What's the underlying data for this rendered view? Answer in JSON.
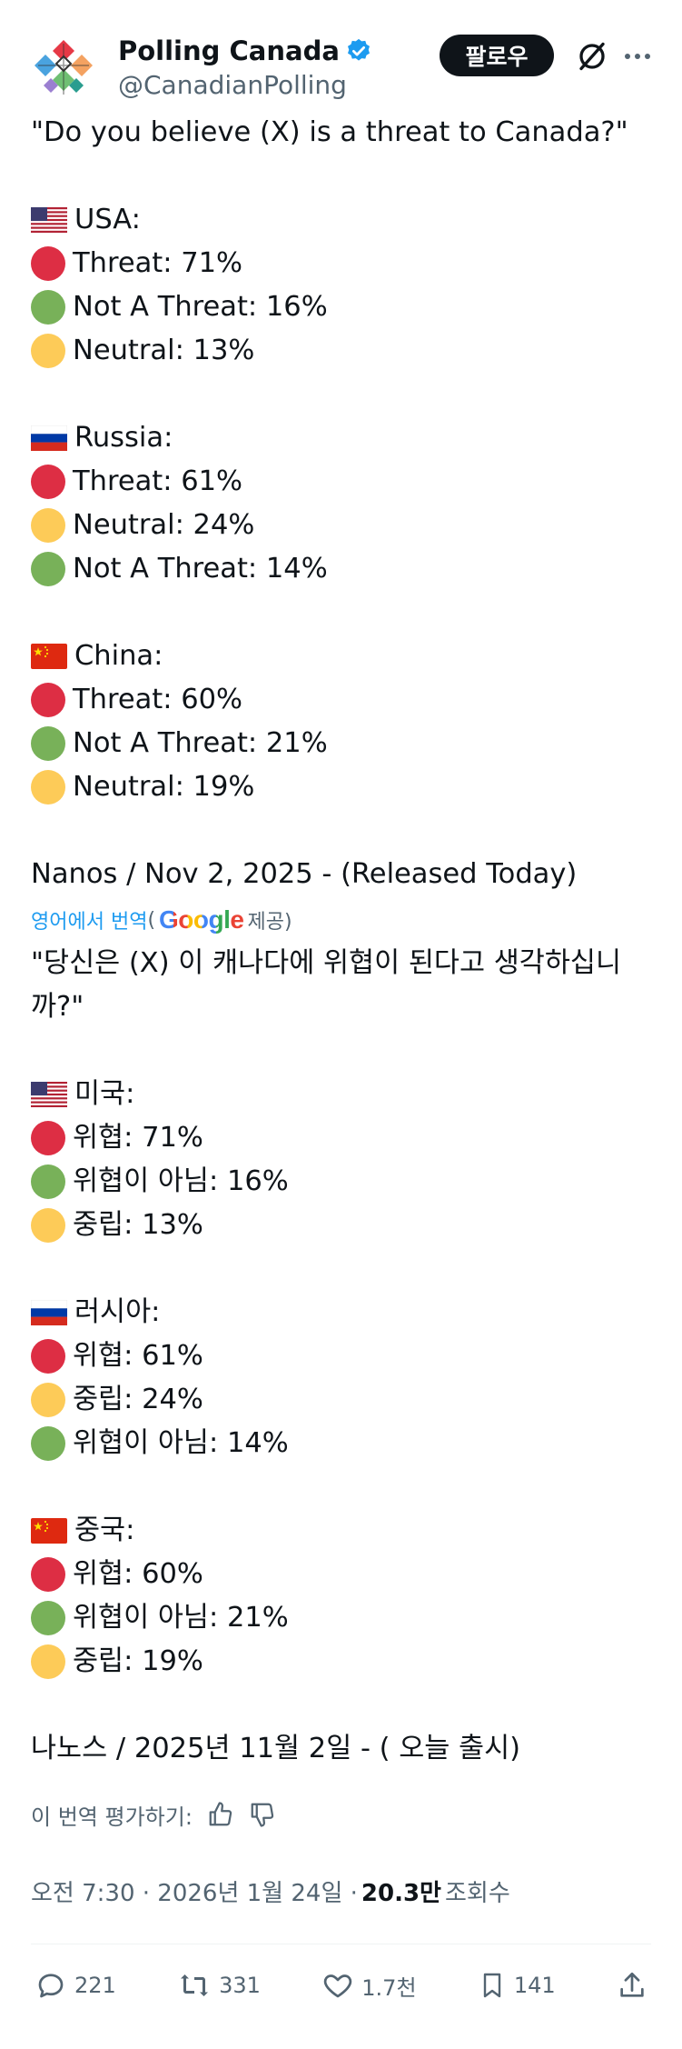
{
  "account": {
    "display_name": "Polling Canada",
    "handle": "@CanadianPolling",
    "follow_label": "팔로우"
  },
  "post": {
    "question": "\"Do you believe (X) is a threat to Canada?\"",
    "sections": [
      {
        "flag": "us",
        "country": "USA:",
        "rows": [
          {
            "color": "red",
            "text": "Threat: 71%"
          },
          {
            "color": "green",
            "text": "Not A Threat: 16%"
          },
          {
            "color": "yellow",
            "text": "Neutral: 13%"
          }
        ]
      },
      {
        "flag": "ru",
        "country": "Russia:",
        "rows": [
          {
            "color": "red",
            "text": "Threat: 61%"
          },
          {
            "color": "yellow",
            "text": "Neutral: 24%"
          },
          {
            "color": "green",
            "text": "Not A Threat: 14%"
          }
        ]
      },
      {
        "flag": "cn",
        "country": "China:",
        "rows": [
          {
            "color": "red",
            "text": "Threat: 60%"
          },
          {
            "color": "green",
            "text": "Not A Threat: 21%"
          },
          {
            "color": "yellow",
            "text": "Neutral: 19%"
          }
        ]
      }
    ],
    "source": "Nanos / Nov 2, 2025 - (Released Today)"
  },
  "translation": {
    "label": "영어에서 번역",
    "provider_open": "(",
    "provider_name": "Google",
    "provider_close": " 제공)",
    "question_line1": "\"당신은 (X) 이 캐나다에 위협이 된다고 생각하십니",
    "question_line2": "까?\"",
    "sections": [
      {
        "flag": "us",
        "country": "미국:",
        "rows": [
          {
            "color": "red",
            "text": "위협: 71%"
          },
          {
            "color": "green",
            "text": "위협이 아님: 16%"
          },
          {
            "color": "yellow",
            "text": "중립: 13%"
          }
        ]
      },
      {
        "flag": "ru",
        "country": "러시아:",
        "rows": [
          {
            "color": "red",
            "text": "위협: 61%"
          },
          {
            "color": "yellow",
            "text": "중립: 24%"
          },
          {
            "color": "green",
            "text": "위협이 아님: 14%"
          }
        ]
      },
      {
        "flag": "cn",
        "country": "중국:",
        "rows": [
          {
            "color": "red",
            "text": "위협: 60%"
          },
          {
            "color": "green",
            "text": "위협이 아님: 21%"
          },
          {
            "color": "yellow",
            "text": "중립: 19%"
          }
        ]
      }
    ],
    "source": "나노스 / 2025년 11월 2일 - ( 오늘 출시)",
    "rate_label": "이 번역 평가하기:"
  },
  "meta": {
    "time_date": "오전 7:30 · 2026년 1월 24일 · ",
    "views_count": "20.3만",
    "views_label": "조회수"
  },
  "actions": {
    "replies": "221",
    "reposts": "331",
    "likes": "1.7천",
    "bookmarks": "141"
  },
  "colors": {
    "red": "#dd2e44",
    "green": "#78b159",
    "yellow": "#fdcb58",
    "verified": "#1d9bf0",
    "link": "#1d9bf0",
    "muted": "#536471"
  }
}
